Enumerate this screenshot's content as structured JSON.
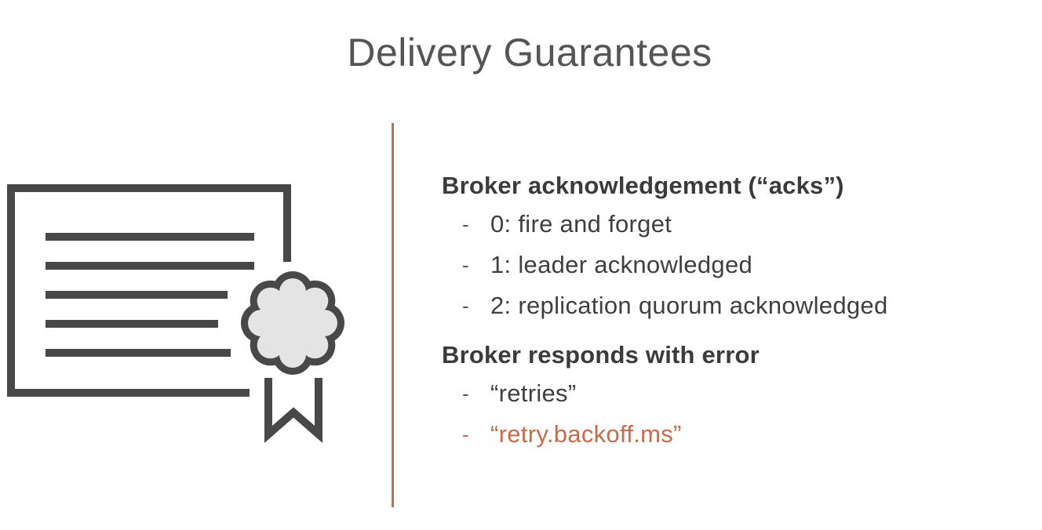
{
  "slide": {
    "title": "Delivery Guarantees",
    "accent_color": "#c96a4b",
    "icon": "certificate-with-seal-icon"
  },
  "sections": [
    {
      "heading": "Broker acknowledgement (“acks”)",
      "items": [
        {
          "dash": "-",
          "text": "0: fire and forget"
        },
        {
          "dash": "-",
          "text": "1: leader acknowledged"
        },
        {
          "dash": "-",
          "text": "2: replication quorum acknowledged"
        }
      ]
    },
    {
      "heading": "Broker responds with error",
      "items": [
        {
          "dash": "-",
          "text": "“retries”"
        },
        {
          "dash": "-",
          "text": "“retry.backoff.ms”",
          "highlighted": true
        }
      ]
    }
  ]
}
